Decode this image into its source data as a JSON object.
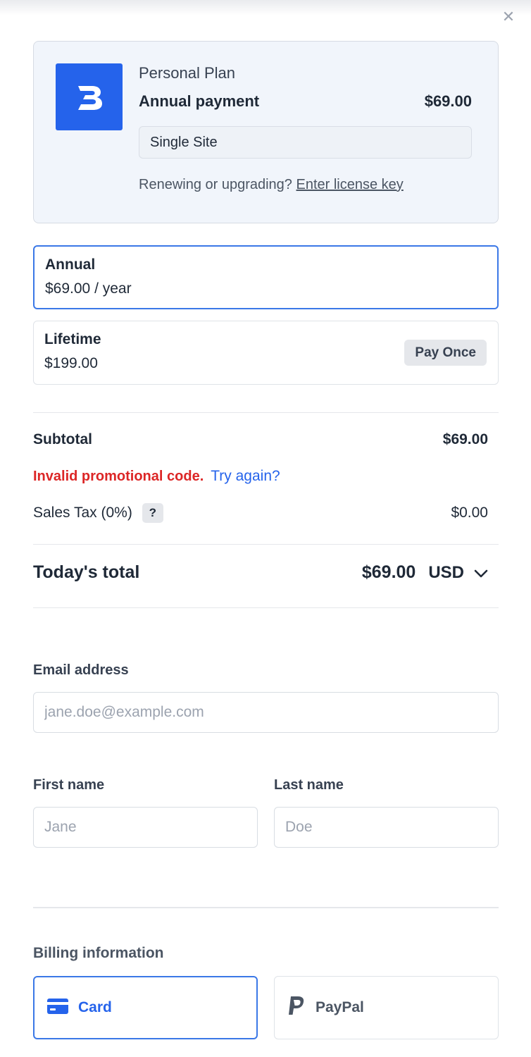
{
  "close": {
    "symbol": "✕"
  },
  "product": {
    "logo_icon": "brand-b-logo-icon",
    "plan_name": "Personal Plan",
    "payment_label": "Annual payment",
    "payment_price": "$69.00",
    "site_option": "Single Site",
    "renew_text": "Renewing or upgrading?",
    "renew_link": "Enter license key"
  },
  "billing_options": [
    {
      "title": "Annual",
      "price": "$69.00 / year",
      "selected": true
    },
    {
      "title": "Lifetime",
      "price": "$199.00",
      "badge": "Pay Once",
      "selected": false
    }
  ],
  "summary": {
    "subtotal_label": "Subtotal",
    "subtotal_value": "$69.00",
    "promo_error": "Invalid promotional code.",
    "promo_retry": "Try again?",
    "tax_label": "Sales Tax (0%)",
    "tax_help": "?",
    "tax_value": "$0.00",
    "total_label": "Today's total",
    "total_value": "$69.00",
    "currency": "USD"
  },
  "form": {
    "email_label": "Email address",
    "email_placeholder": "jane.doe@example.com",
    "first_name_label": "First name",
    "first_name_placeholder": "Jane",
    "last_name_label": "Last name",
    "last_name_placeholder": "Doe"
  },
  "billing_section": {
    "title": "Billing information",
    "methods": [
      {
        "label": "Card",
        "icon": "credit-card-icon",
        "selected": true
      },
      {
        "label": "PayPal",
        "icon": "paypal-icon",
        "selected": false
      }
    ]
  },
  "colors": {
    "accent": "#2563eb",
    "error": "#dc2626",
    "card_background": "#f1f5fb"
  }
}
